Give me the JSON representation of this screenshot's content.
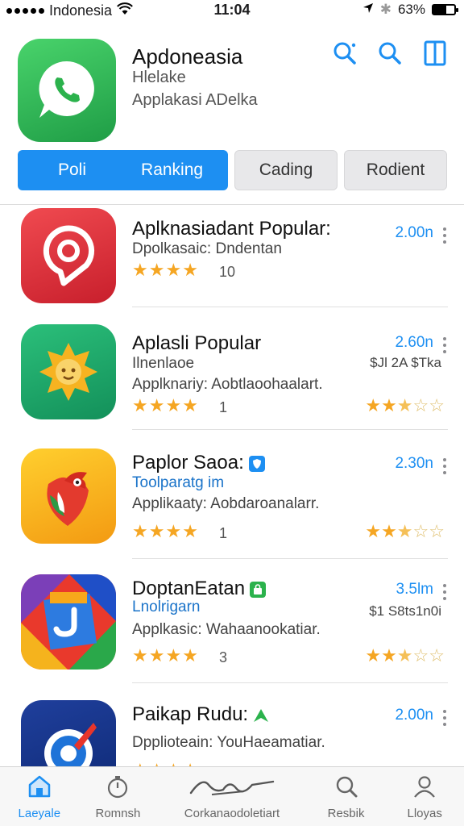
{
  "status_bar": {
    "carrier": "Indonesia",
    "time": "11:04",
    "battery": "63%",
    "battery_level": 0.63
  },
  "header": {
    "title": "Apdoneasia",
    "subtitle": "Hlelake",
    "description": "Applakasi ADelka",
    "icons": [
      "search-sparkle-icon",
      "search-icon",
      "sidebar-icon"
    ]
  },
  "tabs": {
    "active": [
      "Poli",
      "Ranking"
    ],
    "others": [
      "Cading",
      "Rodient"
    ]
  },
  "apps": [
    {
      "title": "Aplknasiadant Popular:",
      "line1": "Dpolkasaic: Dndentan",
      "line2": "",
      "stars": 4,
      "count": "10",
      "size": "2.00n",
      "price": "",
      "right_stars": 0,
      "icon": "red-pin-icon",
      "badge": ""
    },
    {
      "title": "Aplasli Popular",
      "line1": "Ilnenlaoe",
      "line2": "Applknariy: Aobtlaoohaalart.",
      "stars": 4,
      "count": "1",
      "size": "2.60n",
      "price": "$Jl 2A $Tka",
      "right_stars": 2.5,
      "icon": "sun-face-icon",
      "badge": ""
    },
    {
      "title": "Paplor Saoa:",
      "line1": "Toolparatg im",
      "line2": "Applikaaty: Aobdaroanalarr.",
      "stars": 4,
      "count": "1",
      "size": "2.30n",
      "price": "",
      "right_stars": 2.5,
      "icon": "parrot-icon",
      "badge": "blue-shield-icon"
    },
    {
      "title": "DoptanEatan",
      "line1": "Lnolrigarn",
      "line2": "Applkasic: Wahaanookatiar.",
      "stars": 4,
      "count": "3",
      "size": "3.5lm",
      "price": "$1 S8ts1n0i",
      "right_stars": 2.5,
      "icon": "colorful-tile-icon",
      "badge": "green-bag-icon"
    },
    {
      "title": "Paikap Rudu:",
      "line1": "Dpplioteain: YouHaeamatiar.",
      "line2": "",
      "stars": 4,
      "count": "",
      "size": "2.00n",
      "price": "",
      "right_stars": 0,
      "icon": "compass-icon",
      "badge": "green-arrow-icon"
    }
  ],
  "tabbar": [
    {
      "label": "Laeyale",
      "icon": "home-icon"
    },
    {
      "label": "Romnsh",
      "icon": "stopwatch-icon"
    },
    {
      "label": "Corkanaodoletiart",
      "icon": "signature-icon"
    },
    {
      "label": "Resbik",
      "icon": "search-icon"
    },
    {
      "label": "Lloyas",
      "icon": "user-icon"
    }
  ],
  "colors": {
    "accent": "#1d8ff2",
    "star": "#f5a623"
  }
}
